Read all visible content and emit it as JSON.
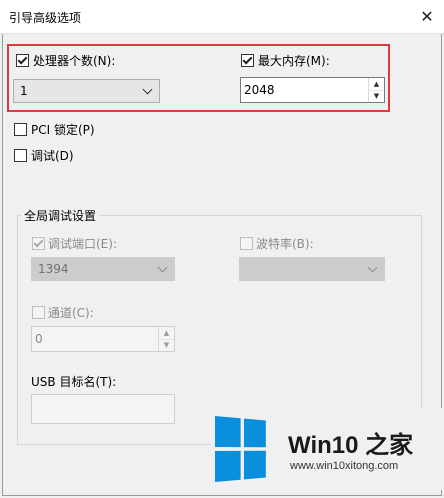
{
  "window": {
    "title": "引导高级选项",
    "close_glyph": "✕"
  },
  "processors": {
    "label": "处理器个数(N):",
    "checked": true,
    "value": "1"
  },
  "memory": {
    "label": "最大内存(M):",
    "checked": true,
    "value": "2048"
  },
  "pci_lock": {
    "label": "PCI 锁定(P)",
    "checked": false
  },
  "debug": {
    "label": "调试(D)",
    "checked": false
  },
  "global_debug": {
    "title": "全局调试设置",
    "debug_port": {
      "label": "调试端口(E):",
      "checked": true,
      "value": "1394"
    },
    "baud_rate": {
      "label": "波特率(B):",
      "checked": false,
      "value": ""
    },
    "channel": {
      "label": "通道(C):",
      "checked": false,
      "value": "0"
    },
    "usb_target": {
      "label": "USB 目标名(T):",
      "value": ""
    }
  },
  "watermark": {
    "title": "Win10 之家",
    "url": "www.win10xitong.com"
  },
  "colors": {
    "highlight": "#e0383f",
    "logo_blue": "#0a8fdc"
  },
  "icons": {
    "close": "close-icon",
    "dropdown": "chevron-down-icon",
    "spin_up": "spin-up-icon",
    "spin_down": "spin-down-icon",
    "logo": "windows-logo-icon"
  }
}
